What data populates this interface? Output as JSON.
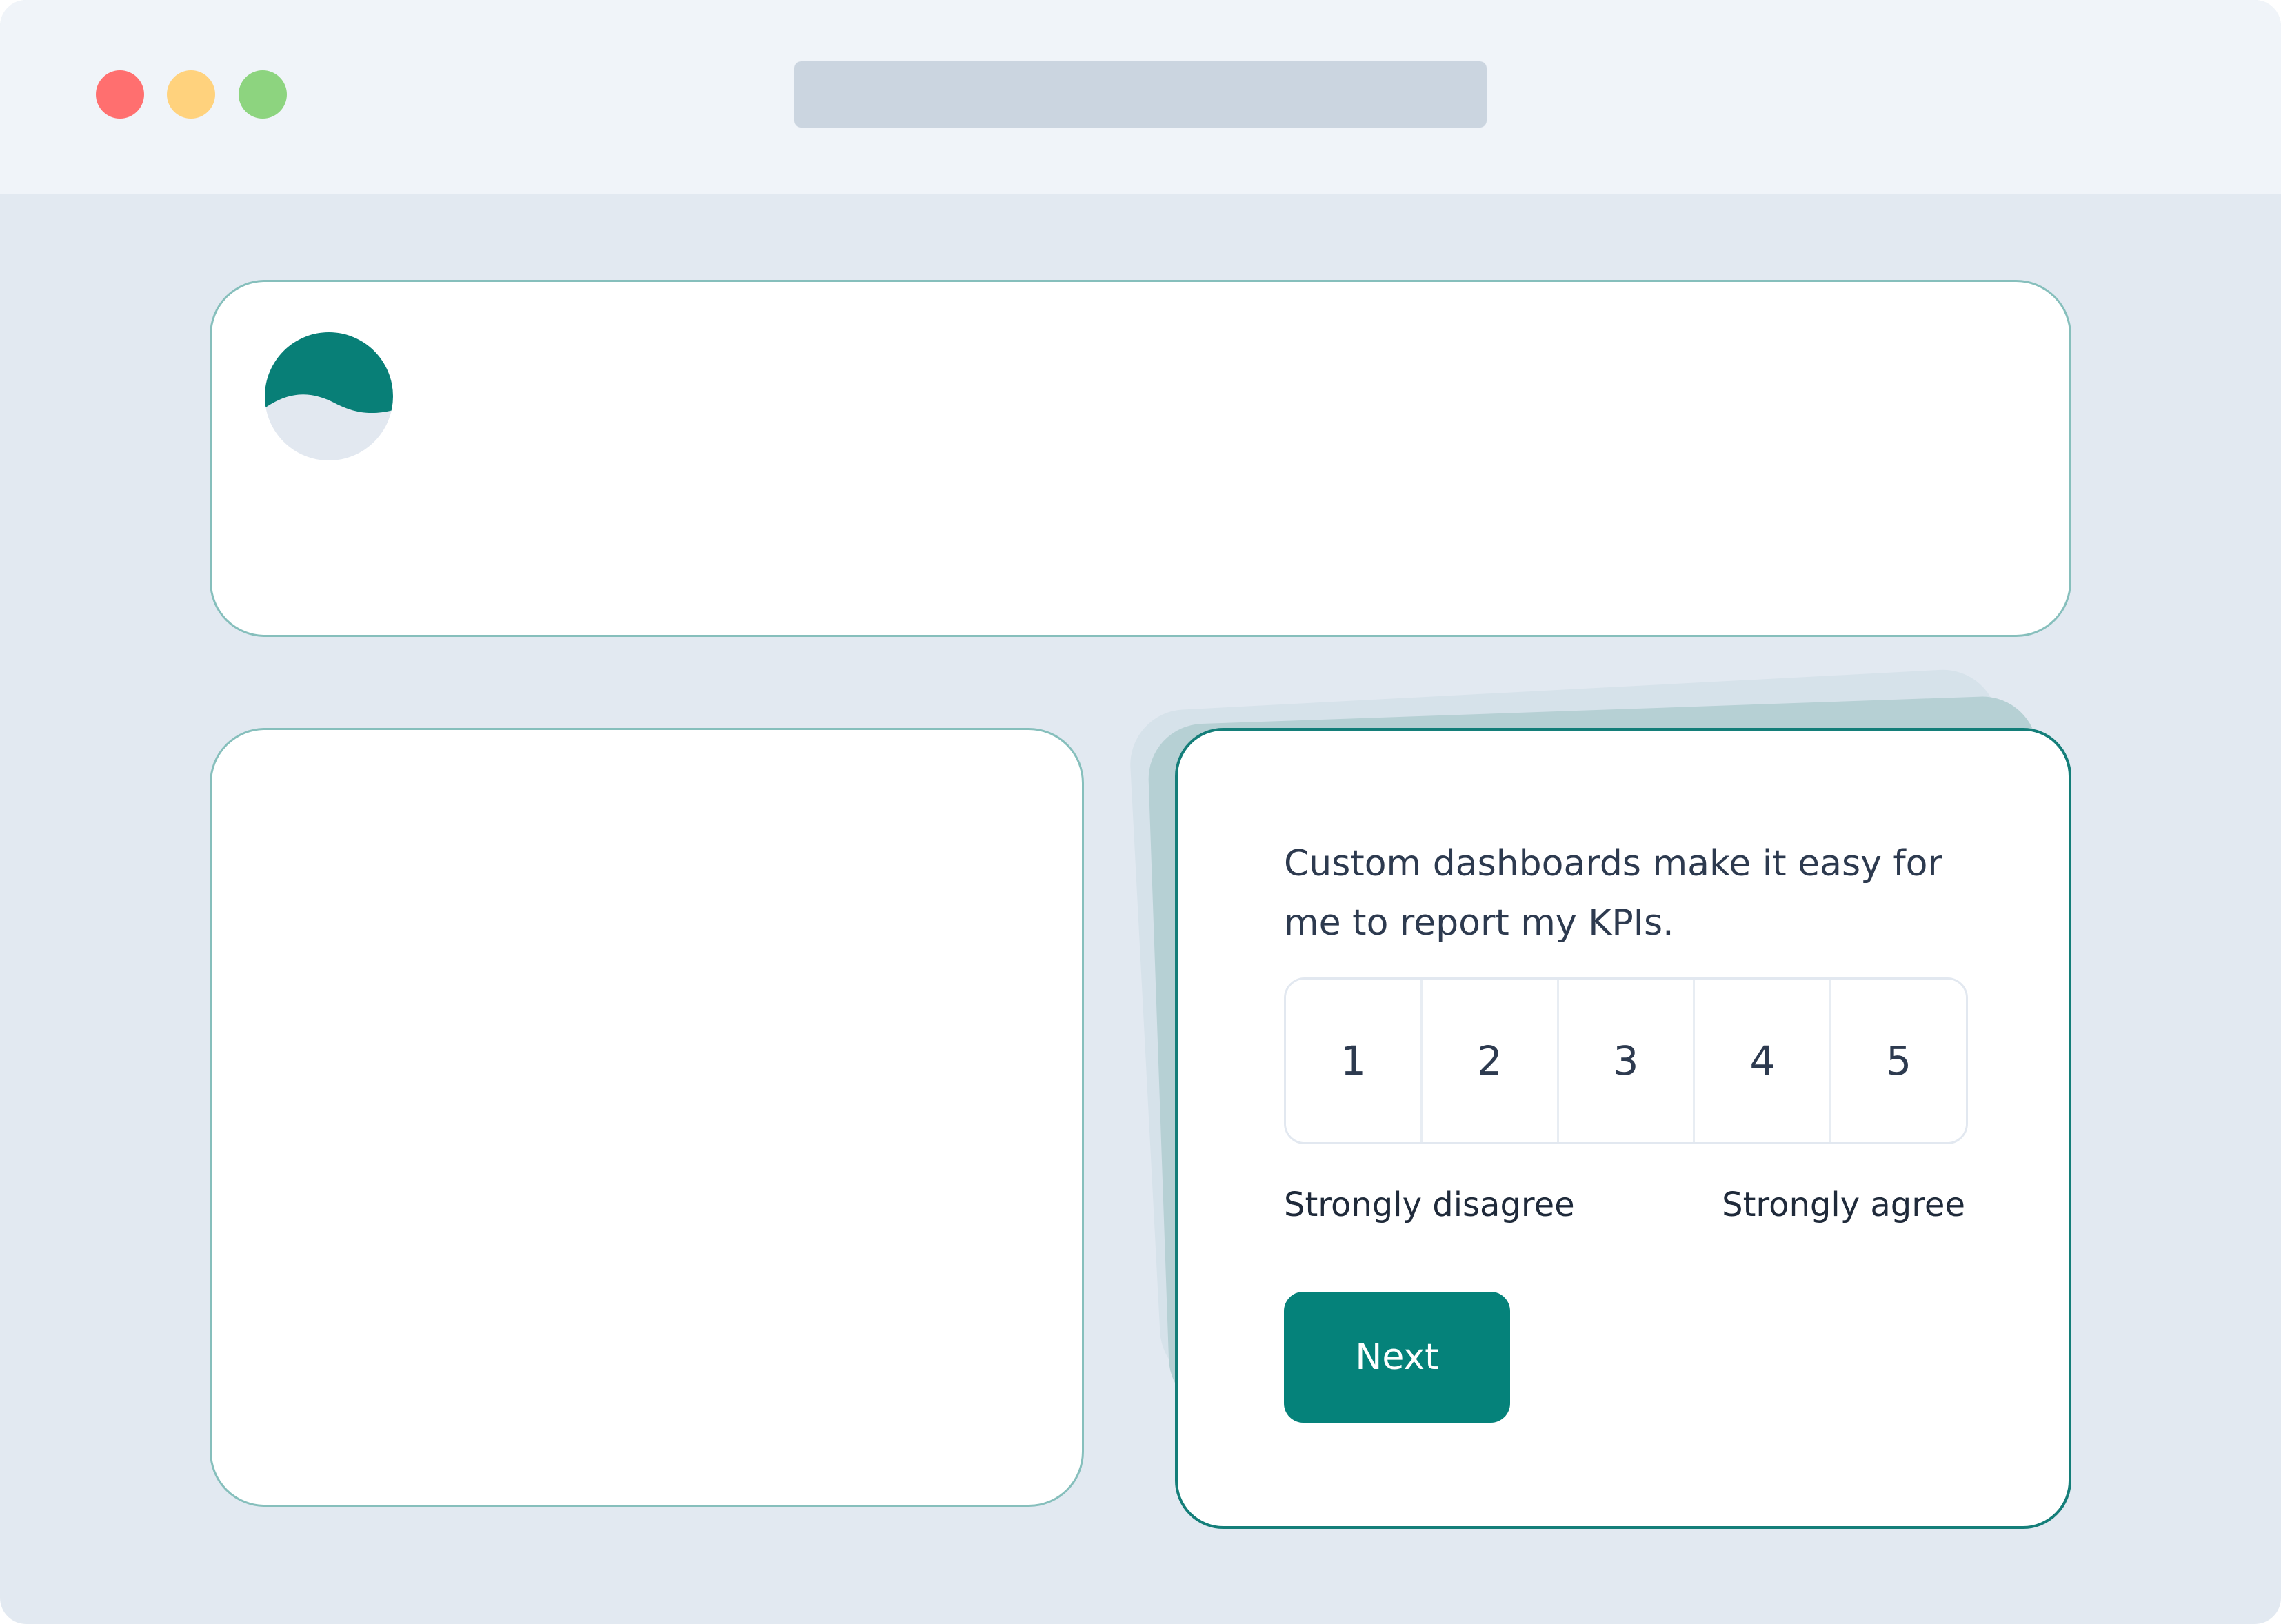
{
  "colors": {
    "dot_red": "#ff6f6f",
    "dot_yellow": "#ffd27d",
    "dot_green": "#8dd47f",
    "accent": "#05827a",
    "logo_dark": "#087f77",
    "logo_light": "#e2e8f0"
  },
  "window": {
    "icons": [
      "close-dot",
      "minimize-dot",
      "maximize-dot"
    ]
  },
  "survey": {
    "question": "Custom dashboards make it easy for me to report my KPIs.",
    "options": [
      "1",
      "2",
      "3",
      "4",
      "5"
    ],
    "low_label": "Strongly disagree",
    "high_label": "Strongly agree",
    "next_label": "Next"
  }
}
